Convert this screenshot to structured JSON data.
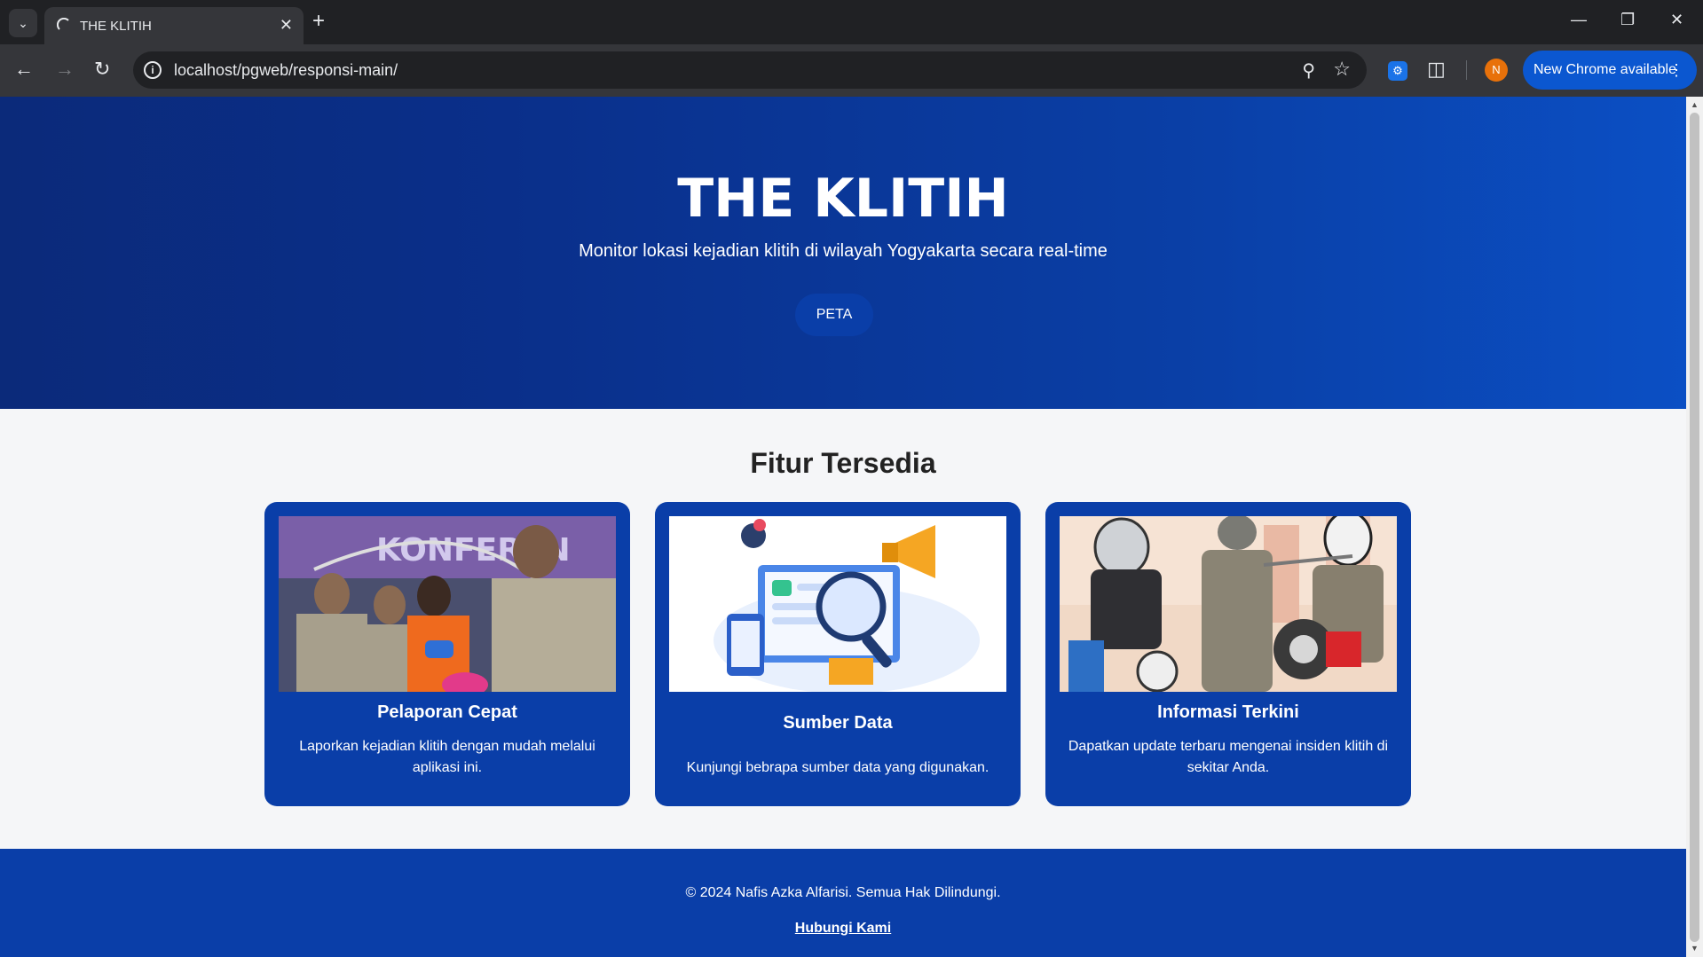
{
  "browser": {
    "tab_title": "THE KLITIH",
    "url": "localhost/pgweb/responsi-main/",
    "update_label": "New Chrome available",
    "avatar_initial": "N"
  },
  "hero": {
    "title": "THE KLITIH",
    "subtitle": "Monitor lokasi kejadian klitih di wilayah Yogyakarta secara real-time",
    "button_label": "PETA"
  },
  "features": {
    "title": "Fitur Tersedia",
    "cards": [
      {
        "title": "Pelaporan Cepat",
        "desc": "Laporkan kejadian klitih dengan mudah melalui aplikasi ini.",
        "image": "police-press-conference-photo"
      },
      {
        "title": "Sumber Data",
        "desc": "Kunjungi bebrapa sumber data yang digunakan.",
        "image": "data-analytics-illustration"
      },
      {
        "title": "Informasi Terkini",
        "desc": "Dapatkan update terbaru mengenai insiden klitih di sekitar Anda.",
        "image": "street-attack-illustration"
      }
    ]
  },
  "footer": {
    "copyright": "© 2024 Nafis Azka Alfarisi. Semua Hak Dilindungi.",
    "contact_label": "Hubungi Kami"
  },
  "colors": {
    "primary": "#0a3ea8",
    "hero_dark": "#0b2a7a",
    "page_bg": "#f5f6f8"
  }
}
